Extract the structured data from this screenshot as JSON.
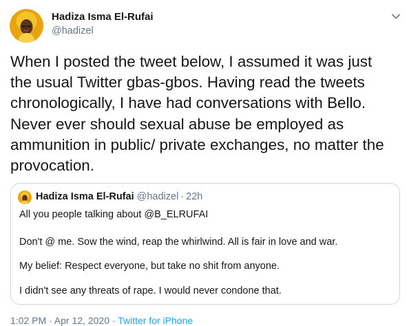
{
  "author": {
    "name": "Hadiza Isma El-Rufai",
    "handle": "@hadizel"
  },
  "menu_icon": "chevron-down-icon",
  "tweet_text": "When I posted the tweet below, I assumed it was just\nthe usual Twitter gbas-gbos. Having read the tweets\nchronologically, I have had conversations with Bello.\nNever ever should sexual abuse be employed as\nammunition in public/ private exchanges, no matter the\nprovocation.",
  "quoted_tweet": {
    "name": "Hadiza Isma El-Rufai",
    "handle": "@hadizel",
    "separator": "·",
    "time": "22h",
    "lines": [
      "All you people talking about @B_ELRUFAI",
      "Don't @ me. Sow the wind, reap the whirlwind. All is fair in love and war.",
      "My belief: Respect everyone, but take no shit from anyone.",
      "I didn't see any threats of rape. I would never condone that."
    ]
  },
  "footer": {
    "timestamp": "1:02 PM · Apr 12, 2020",
    "separator": "·",
    "source": "Twitter for iPhone"
  },
  "colors": {
    "text": "#14171a",
    "secondary": "#657786",
    "border": "#ccd6dd",
    "link": "#1da1f2",
    "avatar_bg": "#f2b417"
  }
}
